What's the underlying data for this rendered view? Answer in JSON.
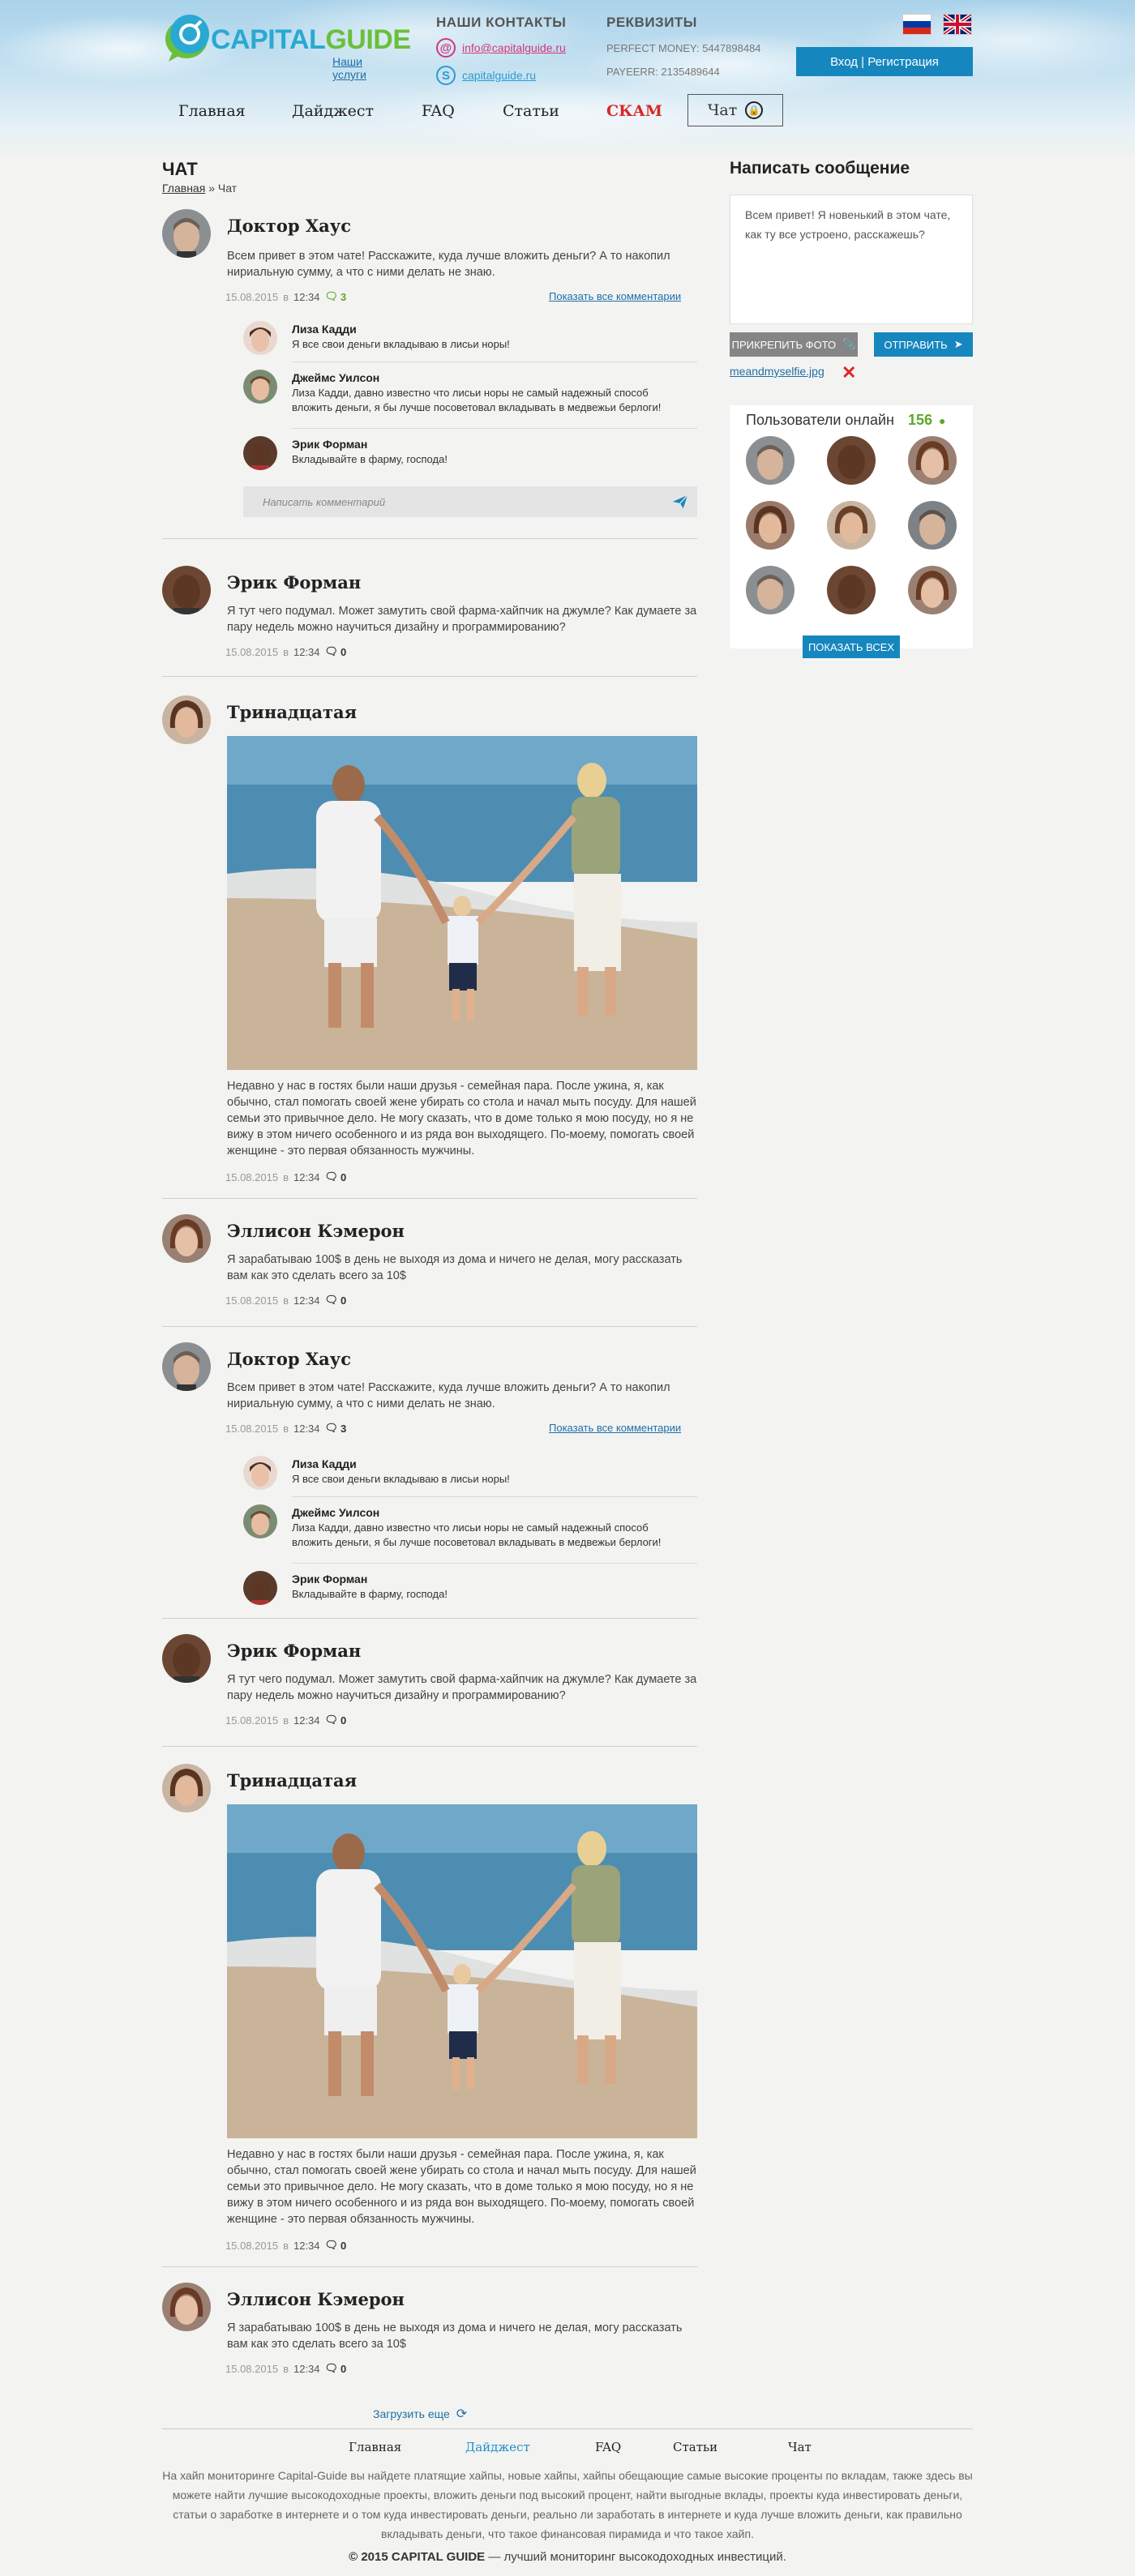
{
  "header": {
    "logo_part1": "CAPITAL",
    "logo_part2": "GUIDE",
    "services_link": "Наши услуги",
    "contacts_title": "НАШИ КОНТАКТЫ",
    "email": "info@capitalguide.ru",
    "skype": "capitalguide.ru",
    "requisites_title": "РЕКВИЗИТЫ",
    "perfect_money": "PERFECT MONEY: 5447898484",
    "payeer": "PAYEERR: 2135489644",
    "login_button": "Вход | Регистрация"
  },
  "nav": {
    "items": [
      "Главная",
      "Дайджест",
      "FAQ",
      "Статьи",
      "СКАМ"
    ],
    "chat": "Чат"
  },
  "page": {
    "title": "ЧАТ",
    "breadcrumb_home": "Главная",
    "breadcrumb_sep": "»",
    "breadcrumb_current": "Чат"
  },
  "posts": [
    {
      "name": "Доктор Хаус",
      "text": "Всем привет в этом чате! Расскажите, куда лучше вложить деньги? А то накопил нириальную сумму, а что с ними делать не знаю.",
      "date": "15.08.2015",
      "in": "в",
      "time": "12:34",
      "comments": "3",
      "all_comments": "Показать все комментарии"
    },
    {
      "name": "Эрик Форман",
      "text": "Я тут чего подумал. Может замутить свой фарма-хайпчик на джумле? Как думаете за пару недель можно научиться дизайну и программированию?",
      "date": "15.08.2015",
      "in": "в",
      "time": "12:34",
      "comments": "0"
    },
    {
      "name": "Тринадцатая",
      "text": "Недавно у нас в гостях были наши друзья - семейная пара. После ужина, я, как обычно, стал помогать своей жене убирать со стола и начал мыть посуду. Для нашей семьи это привычное дело. Не могу сказать, что в доме только я мою посуду, но я не вижу в этом ничего особенного и из ряда вон выходящего. По-моему, помогать своей женщине - это первая обязанность мужчины.",
      "date": "15.08.2015",
      "in": "в",
      "time": "12:34",
      "comments": "0"
    },
    {
      "name": "Эллисон Кэмерон",
      "text": "Я зарабатываю 100$ в день не выходя из дома и ничего не делая, могу рассказать вам как это сделать всего за 10$",
      "date": "15.08.2015",
      "in": "в",
      "time": "12:34",
      "comments": "0"
    }
  ],
  "comments": [
    {
      "name": "Лиза Кадди",
      "text": "Я все свои деньги вкладываю в лисьи норы!"
    },
    {
      "name": "Джеймс Уилсон",
      "text": "Лиза Кадди, давно известно что лисьи норы не самый надежный способ вложить деньги, я бы лучше посоветовал вкладывать в медвежьи берлоги!"
    },
    {
      "name": "Эрик Форман",
      "text": "Вкладывайте в фарму, господа!"
    }
  ],
  "comment_placeholder": "Написать комментарий",
  "sidebar": {
    "title": "Написать сообщение",
    "message": "Всем привет! Я новенький в этом чате, как ту все устроено, расскажешь?",
    "attach": "ПРИКРЕПИТЬ ФОТО",
    "send": "ОТПРАВИТЬ",
    "file": "meandmyselfie.jpg",
    "online_title": "Пользователи онлайн",
    "online_count": "156",
    "show_all": "ПОКАЗАТЬ ВСЕХ"
  },
  "load_more": "Загрузить еще",
  "footer": {
    "nav": [
      "Главная",
      "Дайджест",
      "FAQ",
      "Статьи",
      "Чат"
    ],
    "text": "На хайп мониторинге Capital-Guide вы найдете платящие хайпы, новые хайпы, хайпы обещающие самые высокие проценты по вкладам, также здесь вы можете найти лучшие высокодоходные проекты, вложить деньги под  высокий процент, найти выгодные вклады, проекты куда инвестировать деньги, статьи о заработке в интернете и о том куда инвестировать деньги, реально ли заработать в интернете и куда лучше вложить деньги, как правильно вкладывать деньги, что такое финансовая пирамида и что такое хайп.",
    "copyright_bold": "© 2015 CAPITAL GUIDE",
    "copyright_rest": " — лучший мониторинг высокодоходных инвестиций."
  },
  "colors": {
    "accent": "#1686bf",
    "scam": "#d82727",
    "online": "#5ea72a",
    "email": "#d2377b"
  }
}
